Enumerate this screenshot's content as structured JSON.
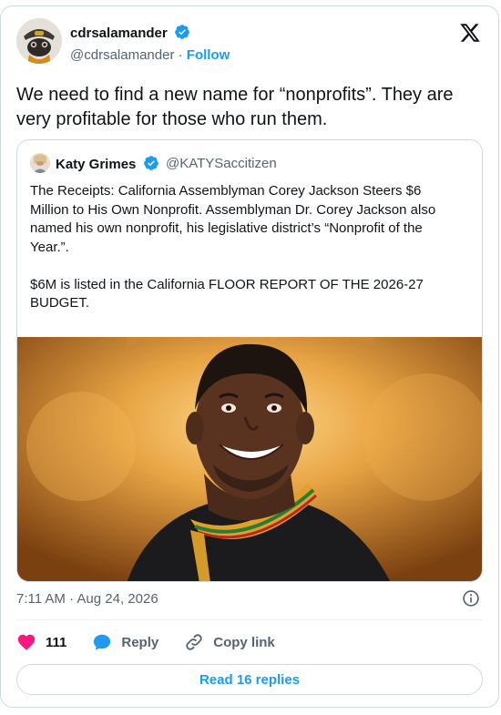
{
  "author": {
    "name": "cdrsalamander",
    "handle": "@cdrsalamander",
    "separator": "·",
    "follow_label": "Follow"
  },
  "tweet": {
    "text": "We need to find a new name for “nonprofits”. They are very profitable for those who run them."
  },
  "quoted": {
    "name": "Katy Grimes",
    "handle": "@KATYSaccitizen",
    "text": "The Receipts: California Assemblyman Corey Jackson Steers $6 Million to His Own Nonprofit. Assemblyman Dr. Corey Jackson also named his own nonprofit, his legislative district’s “Nonprofit of the Year.”.\n\n$6M is listed in the California FLOOR REPORT OF THE 2026-27 BUDGET."
  },
  "meta": {
    "timestamp": "7:11 AM · Aug 24, 2026"
  },
  "actions": {
    "like_count": "111",
    "reply_label": "Reply",
    "copy_link_label": "Copy link"
  },
  "read_replies_label": "Read 16 replies",
  "colors": {
    "accent": "#1d9bf0",
    "like": "#f91880",
    "muted": "#536471",
    "text": "#0f1419",
    "border": "#cfd9de"
  }
}
